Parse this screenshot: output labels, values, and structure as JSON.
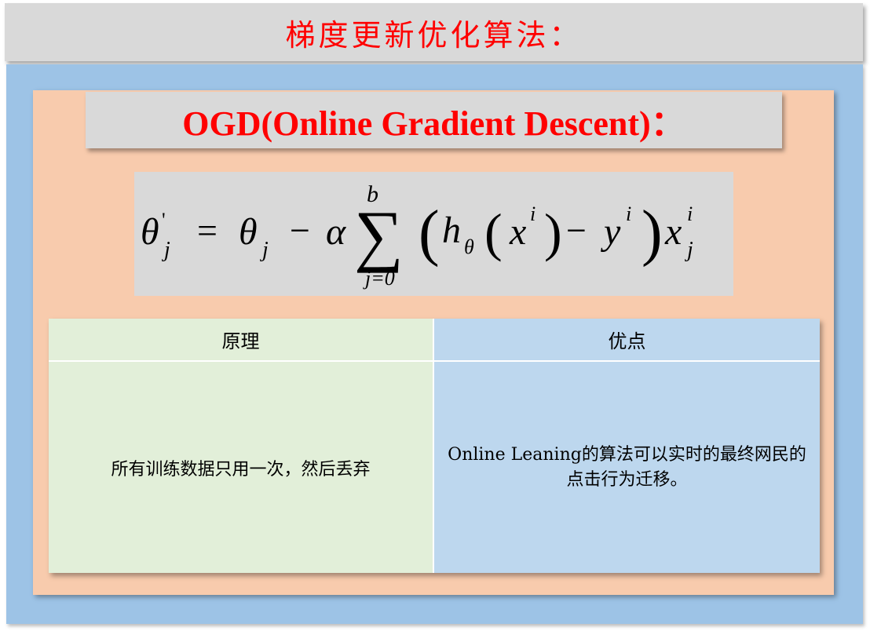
{
  "slide": {
    "title": "梯度更新优化算法：",
    "subtitle": "OGD(Online Gradient Descent)：",
    "formula": {
      "theta": "θ",
      "prime": "'",
      "sub_j": "j",
      "equals": "=",
      "minus": "−",
      "alpha": "α",
      "sigma": "∑",
      "sum_upper": "b",
      "sum_lower": "j=0",
      "lparen": "(",
      "rparen": ")",
      "h": "h",
      "x": "x",
      "y": "y",
      "sup_i": "i"
    },
    "table": {
      "headers": [
        "原理",
        "优点"
      ],
      "rows": [
        [
          "所有训练数据只用一次，然后丢弃",
          "Online Leaning的算法可以实时的最终网民的点击行为迁移。"
        ]
      ]
    },
    "colors": {
      "title_text": "#ff0000",
      "gray_bar": "#d9d9d9",
      "outer_panel": "#9dc3e6",
      "inner_panel": "#f8cbad",
      "green_column": "#e2efd9",
      "blue_column": "#bdd7ee"
    }
  }
}
